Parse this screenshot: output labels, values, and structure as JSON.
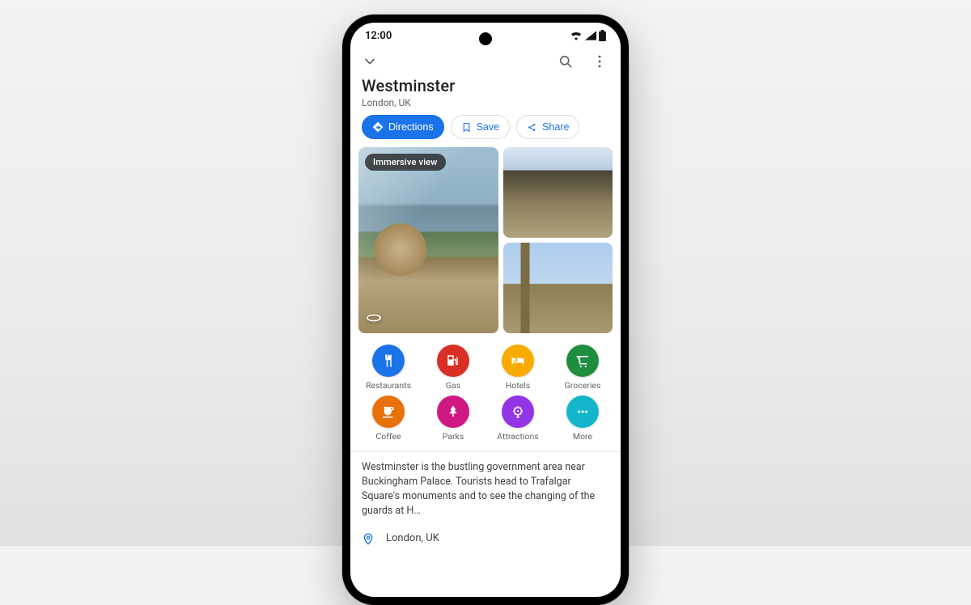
{
  "status": {
    "time": "12:00"
  },
  "place": {
    "title": "Westminster",
    "subtitle": "London, UK"
  },
  "actions": {
    "directions": "Directions",
    "save": "Save",
    "share": "Share"
  },
  "photos": {
    "badge": "Immersive view"
  },
  "categories": [
    {
      "key": "restaurants",
      "label": "Restaurants",
      "color": "c-blue",
      "icon": "fork-knife"
    },
    {
      "key": "gas",
      "label": "Gas",
      "color": "c-red",
      "icon": "gas-pump"
    },
    {
      "key": "hotels",
      "label": "Hotels",
      "color": "c-yellow",
      "icon": "bed"
    },
    {
      "key": "groceries",
      "label": "Groceries",
      "color": "c-green",
      "icon": "cart"
    },
    {
      "key": "coffee",
      "label": "Coffee",
      "color": "c-orange",
      "icon": "cup"
    },
    {
      "key": "parks",
      "label": "Parks",
      "color": "c-pink",
      "icon": "tree"
    },
    {
      "key": "attractions",
      "label": "Attractions",
      "color": "c-purple",
      "icon": "ferris"
    },
    {
      "key": "more",
      "label": "More",
      "color": "c-teal",
      "icon": "dots"
    }
  ],
  "description": "Westminster is the bustling government area near Buckingham Palace. Tourists head to Trafalgar Square's monuments and to see the changing of the guards at H…",
  "location_line": "London, UK"
}
